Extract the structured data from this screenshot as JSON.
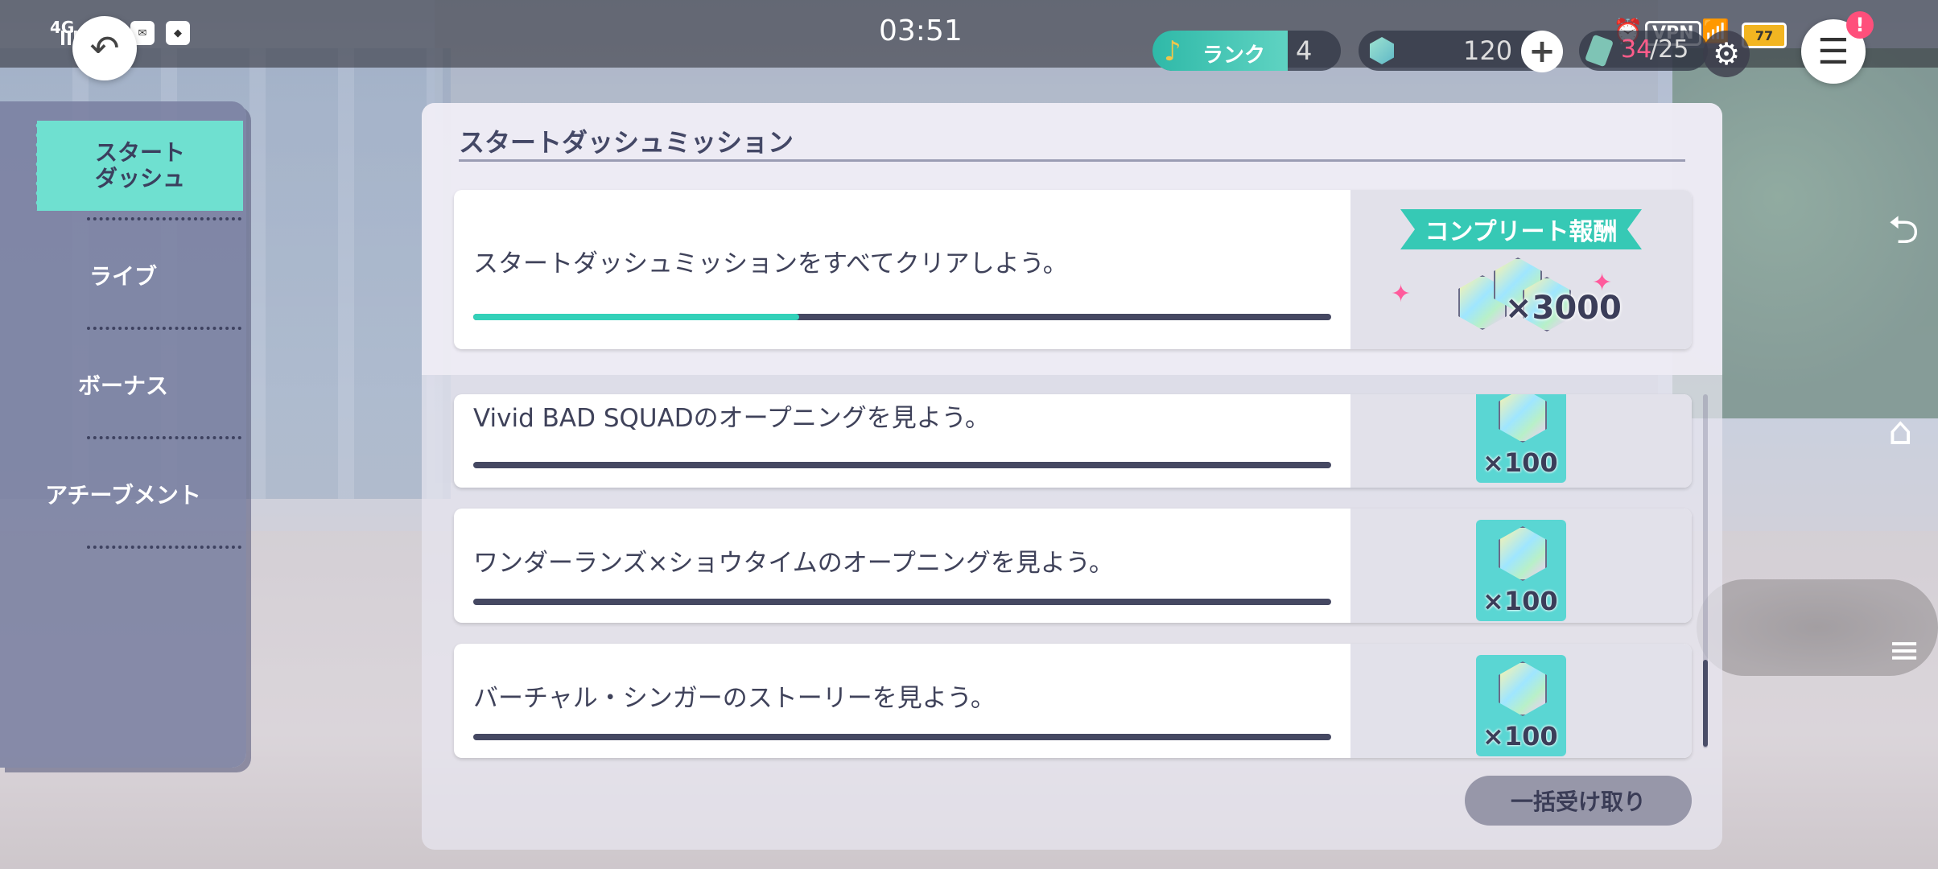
{
  "status_bar": {
    "network": "4G",
    "hd": "HD",
    "time": "03:51",
    "vpn": "VPN",
    "battery": "77"
  },
  "header": {
    "rank_label": "ランク",
    "rank_value": "4",
    "gems": "120",
    "stamina_current": "34",
    "stamina_max": "/25",
    "alert": "!"
  },
  "sidebar": {
    "items": [
      {
        "label": "スタート\nダッシュ",
        "active": true
      },
      {
        "label": "ライブ"
      },
      {
        "label": "ボーナス"
      },
      {
        "label": "アチーブメント"
      }
    ]
  },
  "panel": {
    "title": "スタートダッシュミッション",
    "complete": {
      "text": "スタートダッシュミッションをすべてクリアしよう。",
      "progress": 0.38,
      "reward_banner": "コンプリート報酬",
      "reward_qty": "×3000"
    },
    "missions": [
      {
        "text": "Vivid BAD SQUADのオープニングを見よう。",
        "progress": 0,
        "reward_qty": "×100"
      },
      {
        "text": "ワンダーランズ×ショウタイムのオープニングを見よう。",
        "progress": 0,
        "reward_qty": "×100"
      },
      {
        "text": "バーチャル・シンガーのストーリーを見よう。",
        "progress": 0,
        "reward_qty": "×100"
      }
    ],
    "claim_all": "一括受け取り"
  },
  "colors": {
    "accent": "#33d1b9",
    "sidebar": "#7a7fa0",
    "active_tab": "#6fe0d0",
    "stamina_current": "#ff5c8a"
  }
}
